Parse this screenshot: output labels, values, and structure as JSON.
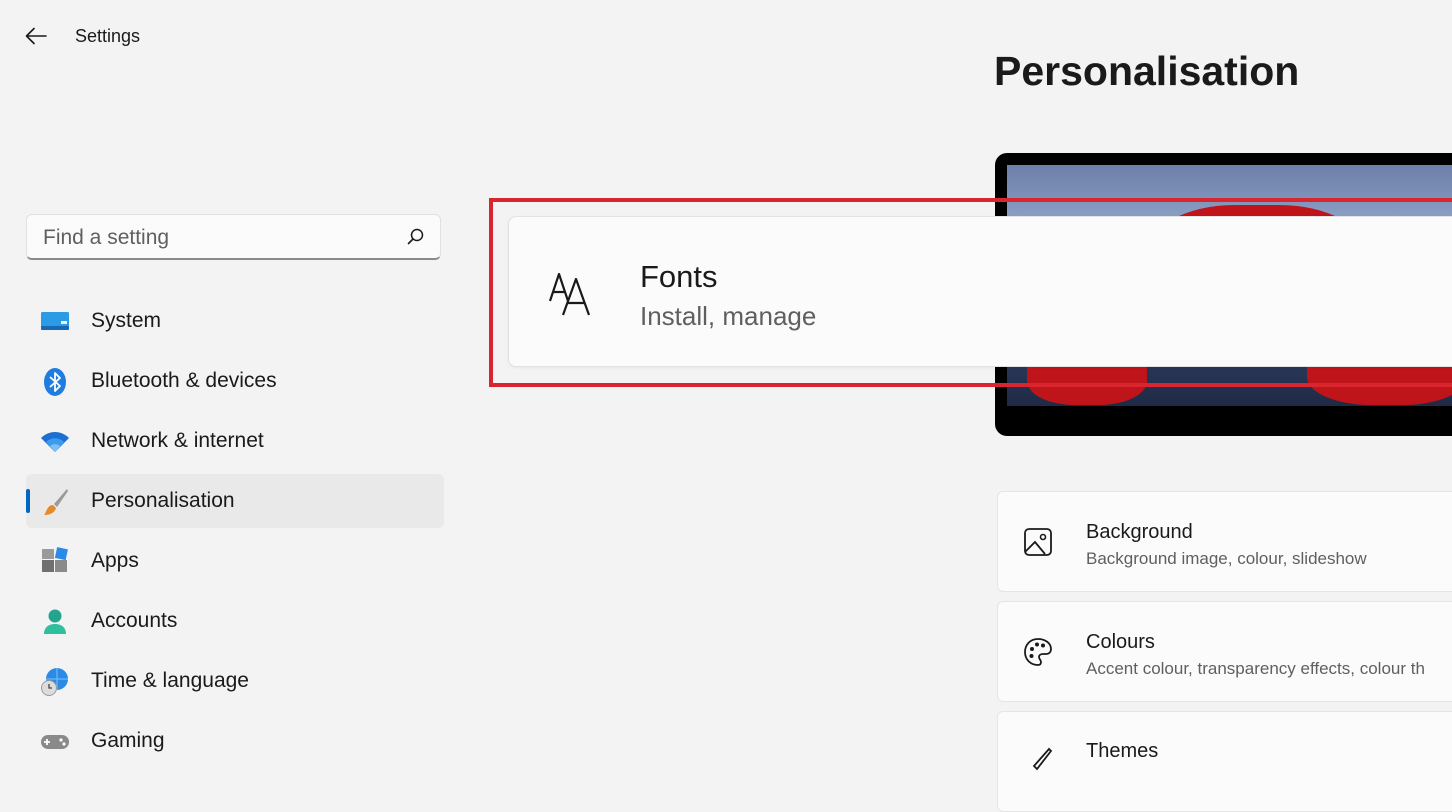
{
  "window": {
    "title": "Settings"
  },
  "search": {
    "placeholder": "Find a setting",
    "value": ""
  },
  "nav": {
    "items": [
      {
        "label": "System",
        "icon": "monitor-icon",
        "selected": false
      },
      {
        "label": "Bluetooth & devices",
        "icon": "bluetooth-icon",
        "selected": false
      },
      {
        "label": "Network & internet",
        "icon": "wifi-icon",
        "selected": false
      },
      {
        "label": "Personalisation",
        "icon": "paintbrush-icon",
        "selected": true
      },
      {
        "label": "Apps",
        "icon": "apps-icon",
        "selected": false
      },
      {
        "label": "Accounts",
        "icon": "person-icon",
        "selected": false
      },
      {
        "label": "Time & language",
        "icon": "globe-clock-icon",
        "selected": false
      },
      {
        "label": "Gaming",
        "icon": "gamepad-icon",
        "selected": false
      }
    ]
  },
  "page": {
    "title": "Personalisation"
  },
  "fonts_card": {
    "title": "Fonts",
    "subtitle": "Install, manage",
    "icon": "font-icon"
  },
  "cards": [
    {
      "title": "Background",
      "subtitle": "Background image, colour, slideshow",
      "icon": "image-icon"
    },
    {
      "title": "Colours",
      "subtitle": "Accent colour, transparency effects, colour th",
      "icon": "palette-icon"
    },
    {
      "title": "Themes",
      "subtitle": "",
      "icon": "brush-icon"
    }
  ],
  "colors": {
    "accent": "#0067c0",
    "highlight_border": "#d9262e",
    "background": "#f3f3f3"
  }
}
